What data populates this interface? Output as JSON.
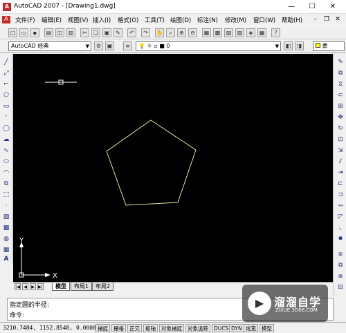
{
  "app": {
    "logo_letter": "A",
    "title": "AutoCAD 2007 - [Drawing1.dwg]"
  },
  "window_controls": {
    "minimize": "—",
    "maximize": "☐",
    "close": "✕"
  },
  "menu": [
    "文件(F)",
    "编辑(E)",
    "视图(V)",
    "插入(I)",
    "格式(O)",
    "工具(T)",
    "绘图(D)",
    "标注(N)",
    "修改(M)",
    "窗口(W)",
    "帮助(H)"
  ],
  "workspace": {
    "value": "AutoCAD 经典"
  },
  "layer": {
    "value": "0"
  },
  "color": {
    "value": "黄"
  },
  "layout_tabs": [
    "模型",
    "布局1",
    "布局2"
  ],
  "ucs": {
    "y": "Y",
    "x": "X"
  },
  "command": {
    "history": "指定圆的半径:",
    "prompt": "命令:"
  },
  "status": {
    "coords": "3210.7484, 1152.8548, 0.0000",
    "toggles": [
      "捕捉",
      "栅格",
      "正交",
      "极轴",
      "对象捕捉",
      "对象追踪",
      "DUCS",
      "DYN",
      "线宽",
      "模型"
    ]
  },
  "watermark": {
    "name": "溜溜自学",
    "url": "ZIXUE.3D66.COM"
  },
  "colors": {
    "canvas": "#000000",
    "pentagon": "#e8e4a0",
    "crosshair": "#ffffff"
  }
}
